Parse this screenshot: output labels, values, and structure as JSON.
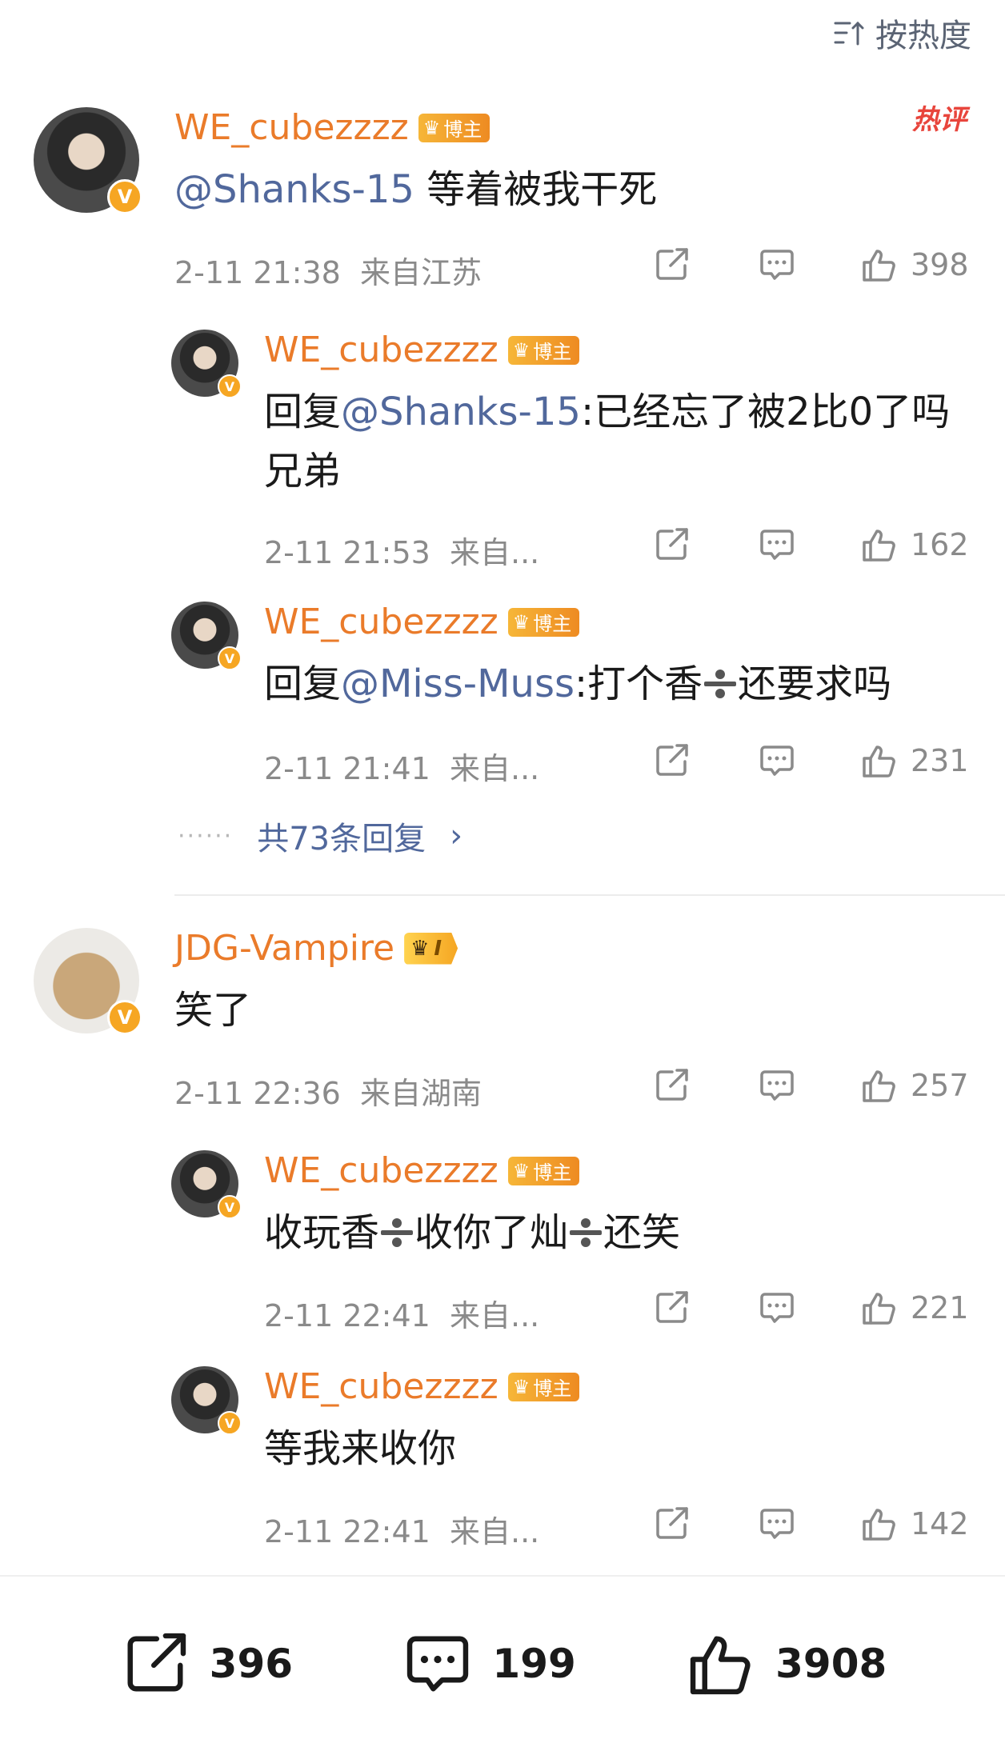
{
  "sort": {
    "icon": "sort-icon",
    "label": "按热度"
  },
  "hot_tag": "热评",
  "comments": [
    {
      "user": "WE_cubezzzz",
      "badge": "博主",
      "text_mention": "@Shanks-15",
      "text_rest": " 等着被我干死",
      "time": "2-11 21:38",
      "location": "来自江苏",
      "likes": "398",
      "replies": [
        {
          "user": "WE_cubezzzz",
          "badge": "博主",
          "reply_prefix": "回复",
          "mention": "@Shanks-15",
          "text": ":已经忘了被2比0了吗兄弟",
          "time": "2-11 21:53",
          "location": "来自...",
          "likes": "162"
        },
        {
          "user": "WE_cubezzzz",
          "badge": "博主",
          "reply_prefix": "回复",
          "mention": "@Miss-Muss",
          "text_a": ":打个香",
          "text_b": "还要求吗",
          "time": "2-11 21:41",
          "location": "来自...",
          "likes": "231"
        }
      ],
      "more_replies": "共73条回复"
    },
    {
      "user": "JDG-Vampire",
      "level": "I",
      "text": "笑了",
      "time": "2-11 22:36",
      "location": "来自湖南",
      "likes": "257",
      "replies": [
        {
          "user": "WE_cubezzzz",
          "badge": "博主",
          "text_a": "收玩香",
          "text_b": "收你了灿",
          "text_c": "还笑",
          "time": "2-11 22:41",
          "location": "来自...",
          "likes": "221"
        },
        {
          "user": "WE_cubezzzz",
          "badge": "博主",
          "text": "等我来收你",
          "time": "2-11 22:41",
          "location": "来自...",
          "likes": "142"
        }
      ]
    }
  ],
  "bottom_bar": {
    "shares": "396",
    "comments": "199",
    "likes": "3908"
  }
}
